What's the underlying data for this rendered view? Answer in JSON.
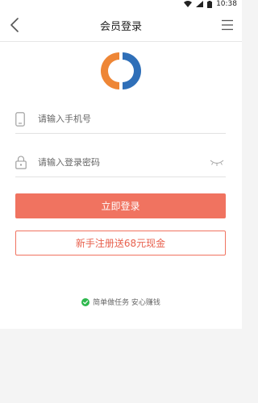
{
  "status_bar": {
    "time": "10:38",
    "icons": [
      "wifi-icon",
      "signal-icon",
      "battery-icon"
    ]
  },
  "header": {
    "title": "会员登录",
    "back_icon": "chevron-left-icon",
    "menu_icon": "hamburger-menu-icon"
  },
  "logo": {
    "icon": "ring-logo",
    "colors": {
      "orange": "#ee8636",
      "blue": "#2f6fb8"
    }
  },
  "form": {
    "phone": {
      "placeholder": "请输入手机号",
      "value": "",
      "icon": "phone-icon"
    },
    "password": {
      "placeholder": "请输入登录密码",
      "value": "",
      "icon": "lock-icon",
      "toggle_icon": "eye-closed-icon"
    }
  },
  "buttons": {
    "login_label": "立即登录",
    "register_label": "新手注册送68元现金"
  },
  "slogan": {
    "text": "简单做任务 安心赚钱",
    "icon": "check-circle-icon"
  },
  "colors": {
    "accent": "#f07360",
    "accent_text": "#e8604d",
    "check": "#2db84d"
  }
}
